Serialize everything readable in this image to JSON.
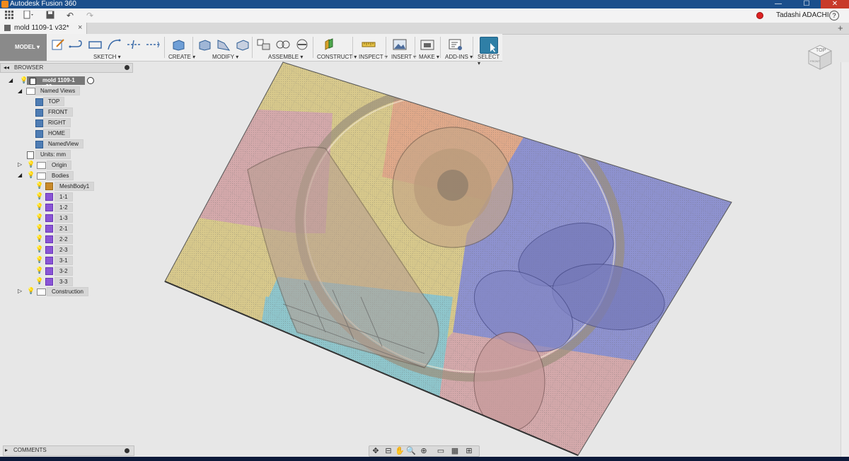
{
  "window": {
    "title": "Autodesk Fusion 360",
    "minimize": "—",
    "maximize": "☐",
    "close": "✕"
  },
  "qat": {
    "user": "Tadashi ADACHI"
  },
  "document": {
    "tab_title": "mold 1109-1 v32*",
    "close": "×"
  },
  "toolbar": {
    "workspace": "MODEL ▾",
    "groups": [
      "SKETCH ▾",
      "CREATE ▾",
      "MODIFY ▾",
      "ASSEMBLE ▾",
      "CONSTRUCT ▾",
      "INSPECT ▾",
      "INSERT ▾",
      "MAKE ▾",
      "ADD-INS ▾",
      "SELECT ▾"
    ]
  },
  "browser": {
    "title": "BROWSER",
    "root": "mold 1109-1 v32",
    "named_views_label": "Named Views",
    "views": [
      "TOP",
      "FRONT",
      "RIGHT",
      "HOME",
      "NamedView"
    ],
    "units": "Units: mm",
    "origin": "Origin",
    "bodies_label": "Bodies",
    "mesh_body": "MeshBody1",
    "bodies": [
      "1-1",
      "1-2",
      "1-3",
      "2-1",
      "2-2",
      "2-3",
      "3-1",
      "3-2",
      "3-3"
    ],
    "construction": "Construction"
  },
  "comments": {
    "label": "COMMENTS"
  },
  "viewcube": {
    "face": "TOP",
    "side": "FRONT"
  },
  "colors": {
    "titlebar": "#1b4f8c",
    "region_yellow": "#d8c98c",
    "region_pink": "#d4a9ab",
    "region_orange": "#e0a98a",
    "region_blue": "#8e92cf",
    "region_cyan": "#8fc6cc"
  }
}
